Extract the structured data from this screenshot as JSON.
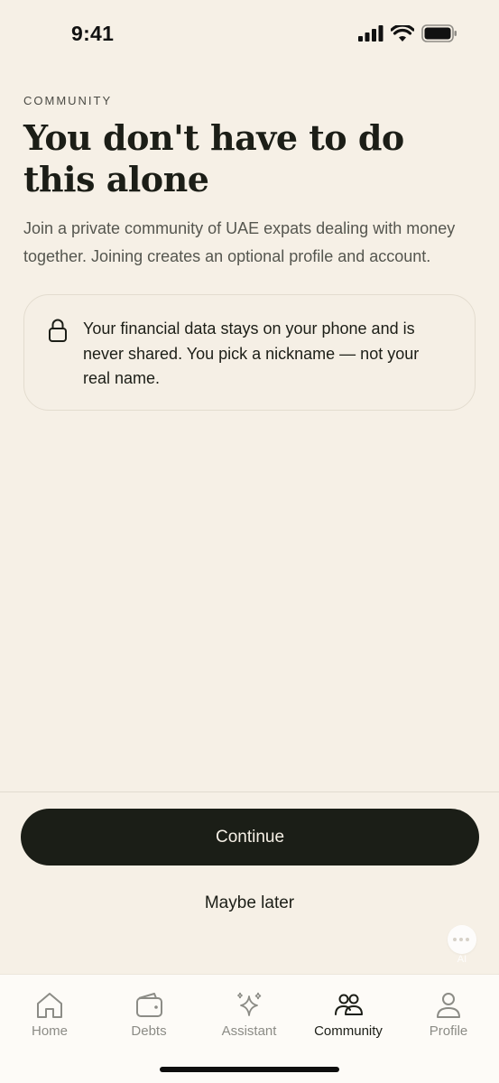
{
  "status_bar": {
    "time": "9:41"
  },
  "header": {
    "eyebrow": "COMMUNITY",
    "title": "You don't have to do this alone",
    "subtitle": "Join a private community of UAE expats dealing with money together. Joining creates an optional profile and account."
  },
  "privacy_card": {
    "icon": "lock-icon",
    "text": "Your financial data stays on your phone and is never shared. You pick a nickname — not your real name."
  },
  "actions": {
    "continue_label": "Continue",
    "later_label": "Maybe later"
  },
  "ai_fab": {
    "label": "AI"
  },
  "tab_bar": {
    "active": "Community",
    "items": [
      {
        "label": "Home",
        "icon": "home-icon"
      },
      {
        "label": "Debts",
        "icon": "wallet-icon"
      },
      {
        "label": "Assistant",
        "icon": "sparkle-icon"
      },
      {
        "label": "Community",
        "icon": "people-icon"
      },
      {
        "label": "Profile",
        "icon": "person-icon"
      }
    ]
  },
  "colors": {
    "background": "#f6f0e6",
    "primary_button": "#1b1e17",
    "text": "#1c1e17",
    "muted": "#8c8c86"
  }
}
